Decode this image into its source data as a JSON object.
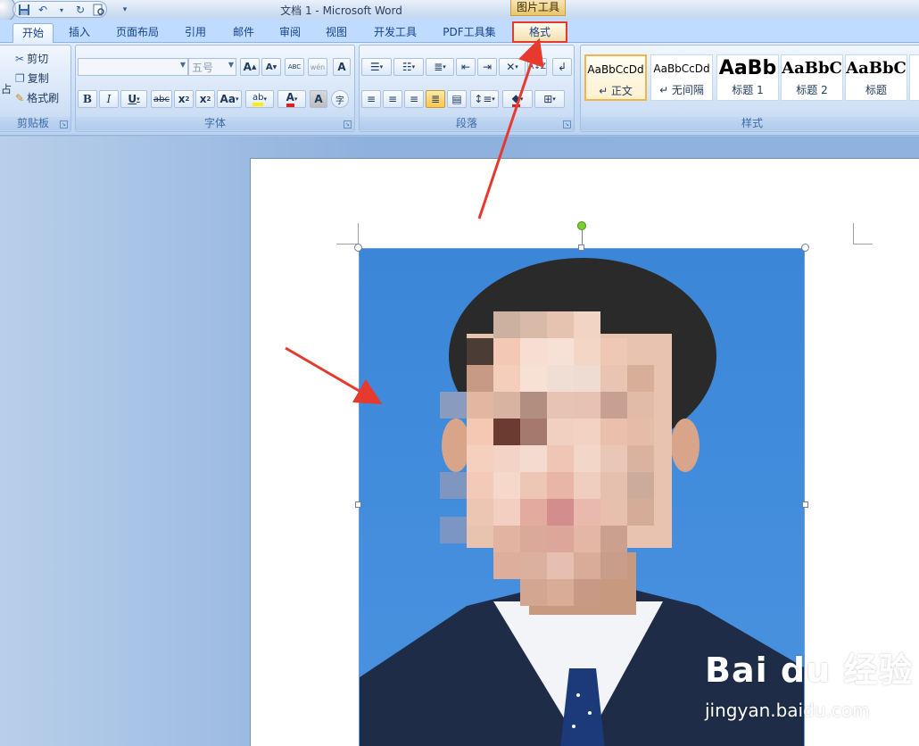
{
  "window": {
    "title": "文档 1 - Microsoft Word",
    "contextual_tab_group": "图片工具"
  },
  "tabs": [
    {
      "label": "开始",
      "active": true
    },
    {
      "label": "插入"
    },
    {
      "label": "页面布局"
    },
    {
      "label": "引用"
    },
    {
      "label": "邮件"
    },
    {
      "label": "审阅"
    },
    {
      "label": "视图"
    },
    {
      "label": "开发工具"
    },
    {
      "label": "PDF工具集"
    },
    {
      "label": "格式",
      "highlighted": true
    }
  ],
  "clipboard": {
    "paste_fragment": "占",
    "cut": "剪切",
    "copy": "复制",
    "format_painter": "格式刷",
    "group_label": "剪贴板"
  },
  "font": {
    "font_name_value": "",
    "font_size_value": "五号",
    "grow": "A",
    "shrink": "A",
    "clear_format": "ABC",
    "phonetic": "wén",
    "border_char": "A",
    "bold": "B",
    "italic": "I",
    "underline": "U",
    "strike": "abc",
    "subscript": "x",
    "superscript": "x",
    "change_case": "Aa",
    "highlight": "ab",
    "font_color": "A",
    "shading": "A",
    "enclose": "字",
    "group_label": "字体"
  },
  "paragraph": {
    "group_label": "段落"
  },
  "styles": {
    "group_label": "样式",
    "items": [
      {
        "sample": "AaBbCcDd",
        "name": "↵ 正文",
        "selected": true
      },
      {
        "sample": "AaBbCcDd",
        "name": "↵ 无间隔"
      },
      {
        "sample": "AaBb",
        "name": "标题 1"
      },
      {
        "sample": "AaBbC",
        "name": "标题 2"
      },
      {
        "sample": "AaBbC",
        "name": "标题"
      }
    ]
  },
  "watermark": {
    "logo": "Bai du 经验",
    "url": "jingyan.baidu.com"
  },
  "colors": {
    "accent_red": "#e53a2d",
    "photo_bg": "#3d87d8",
    "ribbon_tab_text": "#15428b"
  }
}
